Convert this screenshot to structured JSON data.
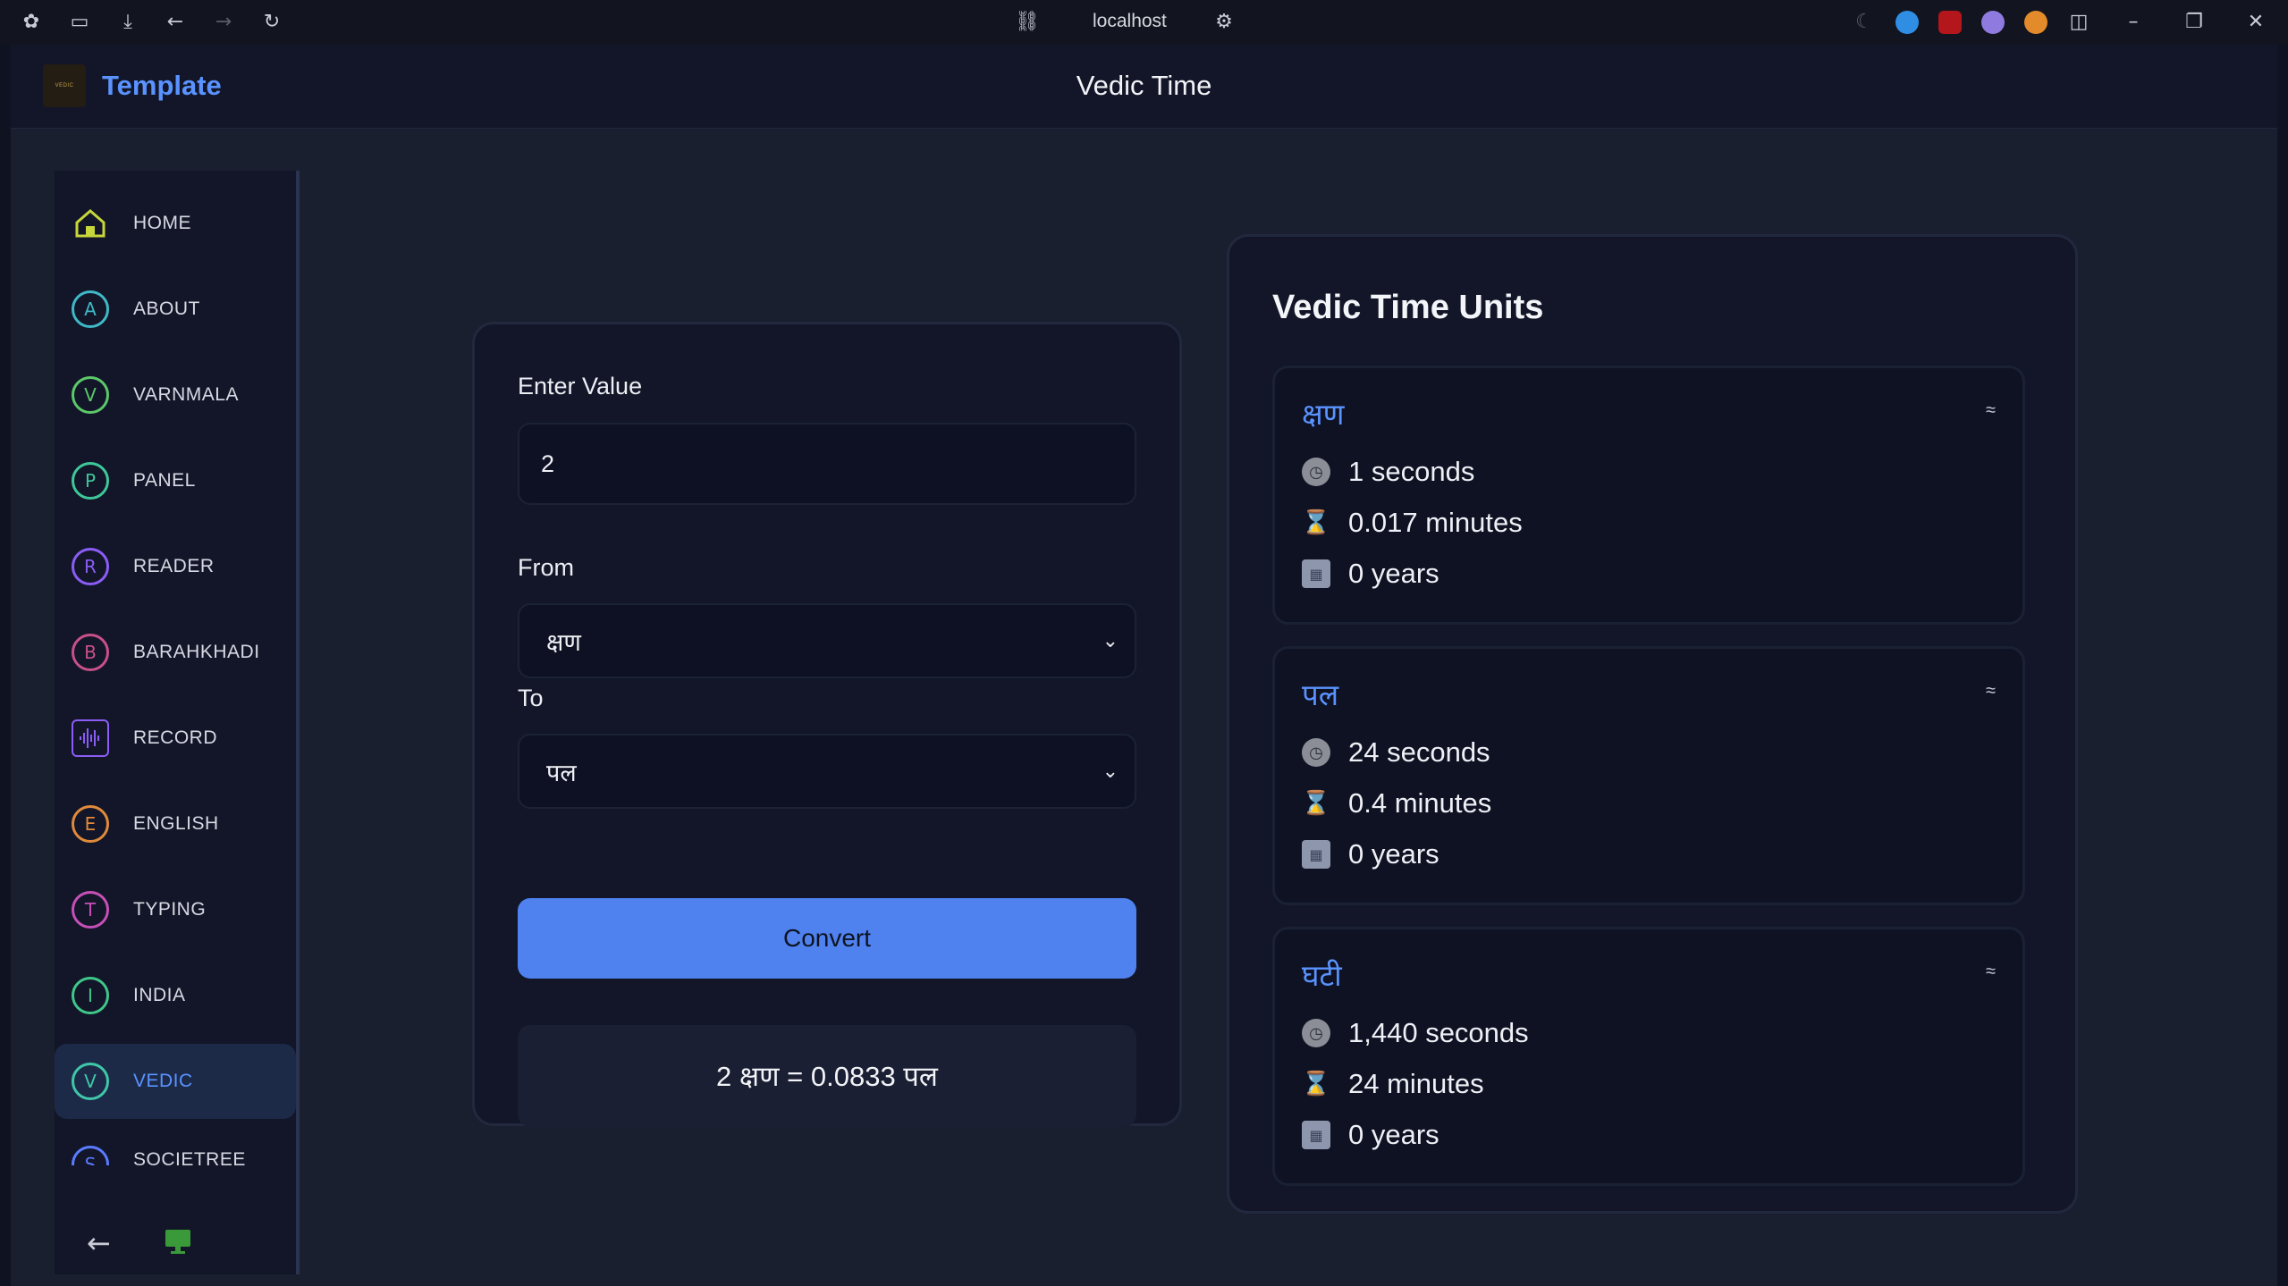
{
  "browser": {
    "url": "localhost"
  },
  "app": {
    "brand": "Template",
    "logo_text": "VEDIC",
    "page_title": "Vedic Time"
  },
  "sidebar": {
    "items": [
      {
        "label": "HOME",
        "icon": "home-icon",
        "letter": "",
        "color": "#c7d63a"
      },
      {
        "label": "ABOUT",
        "icon": "letter-a-icon",
        "letter": "A",
        "color": "#3fb8c7"
      },
      {
        "label": "VARNMALA",
        "icon": "letter-v-icon",
        "letter": "V",
        "color": "#5cc86a"
      },
      {
        "label": "PANEL",
        "icon": "letter-p-icon",
        "letter": "P",
        "color": "#3fc79a"
      },
      {
        "label": "READER",
        "icon": "letter-r-icon",
        "letter": "R",
        "color": "#8b5cf6"
      },
      {
        "label": "BARAHKHADI",
        "icon": "letter-b-icon",
        "letter": "B",
        "color": "#c7508a"
      },
      {
        "label": "RECORD",
        "icon": "waveform-icon",
        "letter": "",
        "color": "#8b5cf6"
      },
      {
        "label": "ENGLISH",
        "icon": "letter-e-icon",
        "letter": "E",
        "color": "#e08a3c"
      },
      {
        "label": "TYPING",
        "icon": "letter-t-icon",
        "letter": "T",
        "color": "#c74fb8"
      },
      {
        "label": "INDIA",
        "icon": "letter-i-icon",
        "letter": "I",
        "color": "#3fc78a"
      },
      {
        "label": "VEDIC",
        "icon": "letter-v-icon",
        "letter": "V",
        "color": "#3fc7a8",
        "active": true
      },
      {
        "label": "SOCIETREE",
        "icon": "letter-s-icon",
        "letter": "S",
        "color": "#5a7bff"
      }
    ],
    "bottom": {
      "back_icon": "arrow-left-icon",
      "monitor_icon": "monitor-icon"
    }
  },
  "converter": {
    "value_label": "Enter Value",
    "value": "2",
    "from_label": "From",
    "from_value": "क्षण",
    "to_label": "To",
    "to_value": "पल",
    "convert_label": "Convert",
    "result": "2 क्षण = 0.0833 पल"
  },
  "units_panel": {
    "title": "Vedic Time Units",
    "units": [
      {
        "name": "क्षण",
        "approx": "≈",
        "seconds": "1 seconds",
        "minutes": "0.017 minutes",
        "years": "0 years"
      },
      {
        "name": "पल",
        "approx": "≈",
        "seconds": "24 seconds",
        "minutes": "0.4 minutes",
        "years": "0 years"
      },
      {
        "name": "घटी",
        "approx": "≈",
        "seconds": "1,440 seconds",
        "minutes": "24 minutes",
        "years": "0 years"
      }
    ]
  }
}
